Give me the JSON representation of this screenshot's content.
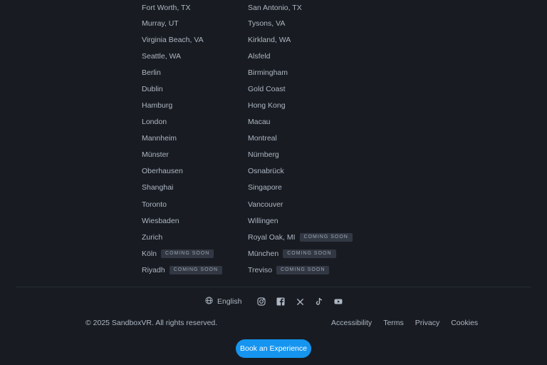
{
  "locations": {
    "left": [
      {
        "name": "Fort Worth, TX"
      },
      {
        "name": "Murray, UT"
      },
      {
        "name": "Virginia Beach, VA"
      },
      {
        "name": "Seattle, WA"
      },
      {
        "name": "Berlin"
      },
      {
        "name": "Dublin"
      },
      {
        "name": "Hamburg"
      },
      {
        "name": "London"
      },
      {
        "name": "Mannheim"
      },
      {
        "name": "Münster"
      },
      {
        "name": "Oberhausen"
      },
      {
        "name": "Shanghai"
      },
      {
        "name": "Toronto"
      },
      {
        "name": "Wiesbaden"
      },
      {
        "name": "Zurich"
      },
      {
        "name": "Köln",
        "badge": "COMING SOON"
      },
      {
        "name": "Riyadh",
        "badge": "COMING SOON"
      }
    ],
    "right": [
      {
        "name": "San Antonio, TX"
      },
      {
        "name": "Tysons, VA"
      },
      {
        "name": "Kirkland, WA"
      },
      {
        "name": "Alsfeld"
      },
      {
        "name": "Birmingham"
      },
      {
        "name": "Gold Coast"
      },
      {
        "name": "Hong Kong"
      },
      {
        "name": "Macau"
      },
      {
        "name": "Montreal"
      },
      {
        "name": "Nürnberg"
      },
      {
        "name": "Osnabrück"
      },
      {
        "name": "Singapore"
      },
      {
        "name": "Vancouver"
      },
      {
        "name": "Willingen"
      },
      {
        "name": "Royal Oak, MI",
        "badge": "COMING SOON"
      },
      {
        "name": "München",
        "badge": "COMING SOON"
      },
      {
        "name": "Treviso",
        "badge": "COMING SOON"
      }
    ]
  },
  "footer": {
    "language": "English",
    "language_icon": "globe-icon",
    "social_icons": [
      "instagram-icon",
      "facebook-icon",
      "x-icon",
      "tiktok-icon",
      "youtube-icon"
    ],
    "copyright": "© 2025 SandboxVR. All rights reserved.",
    "legal_links": [
      "Accessibility",
      "Terms",
      "Privacy",
      "Cookies"
    ],
    "cta": "Book an Experience"
  },
  "colors": {
    "background": "#181c22",
    "text": "#aeb6c2",
    "badge_bg": "#323843",
    "cta": "#1595f0"
  }
}
